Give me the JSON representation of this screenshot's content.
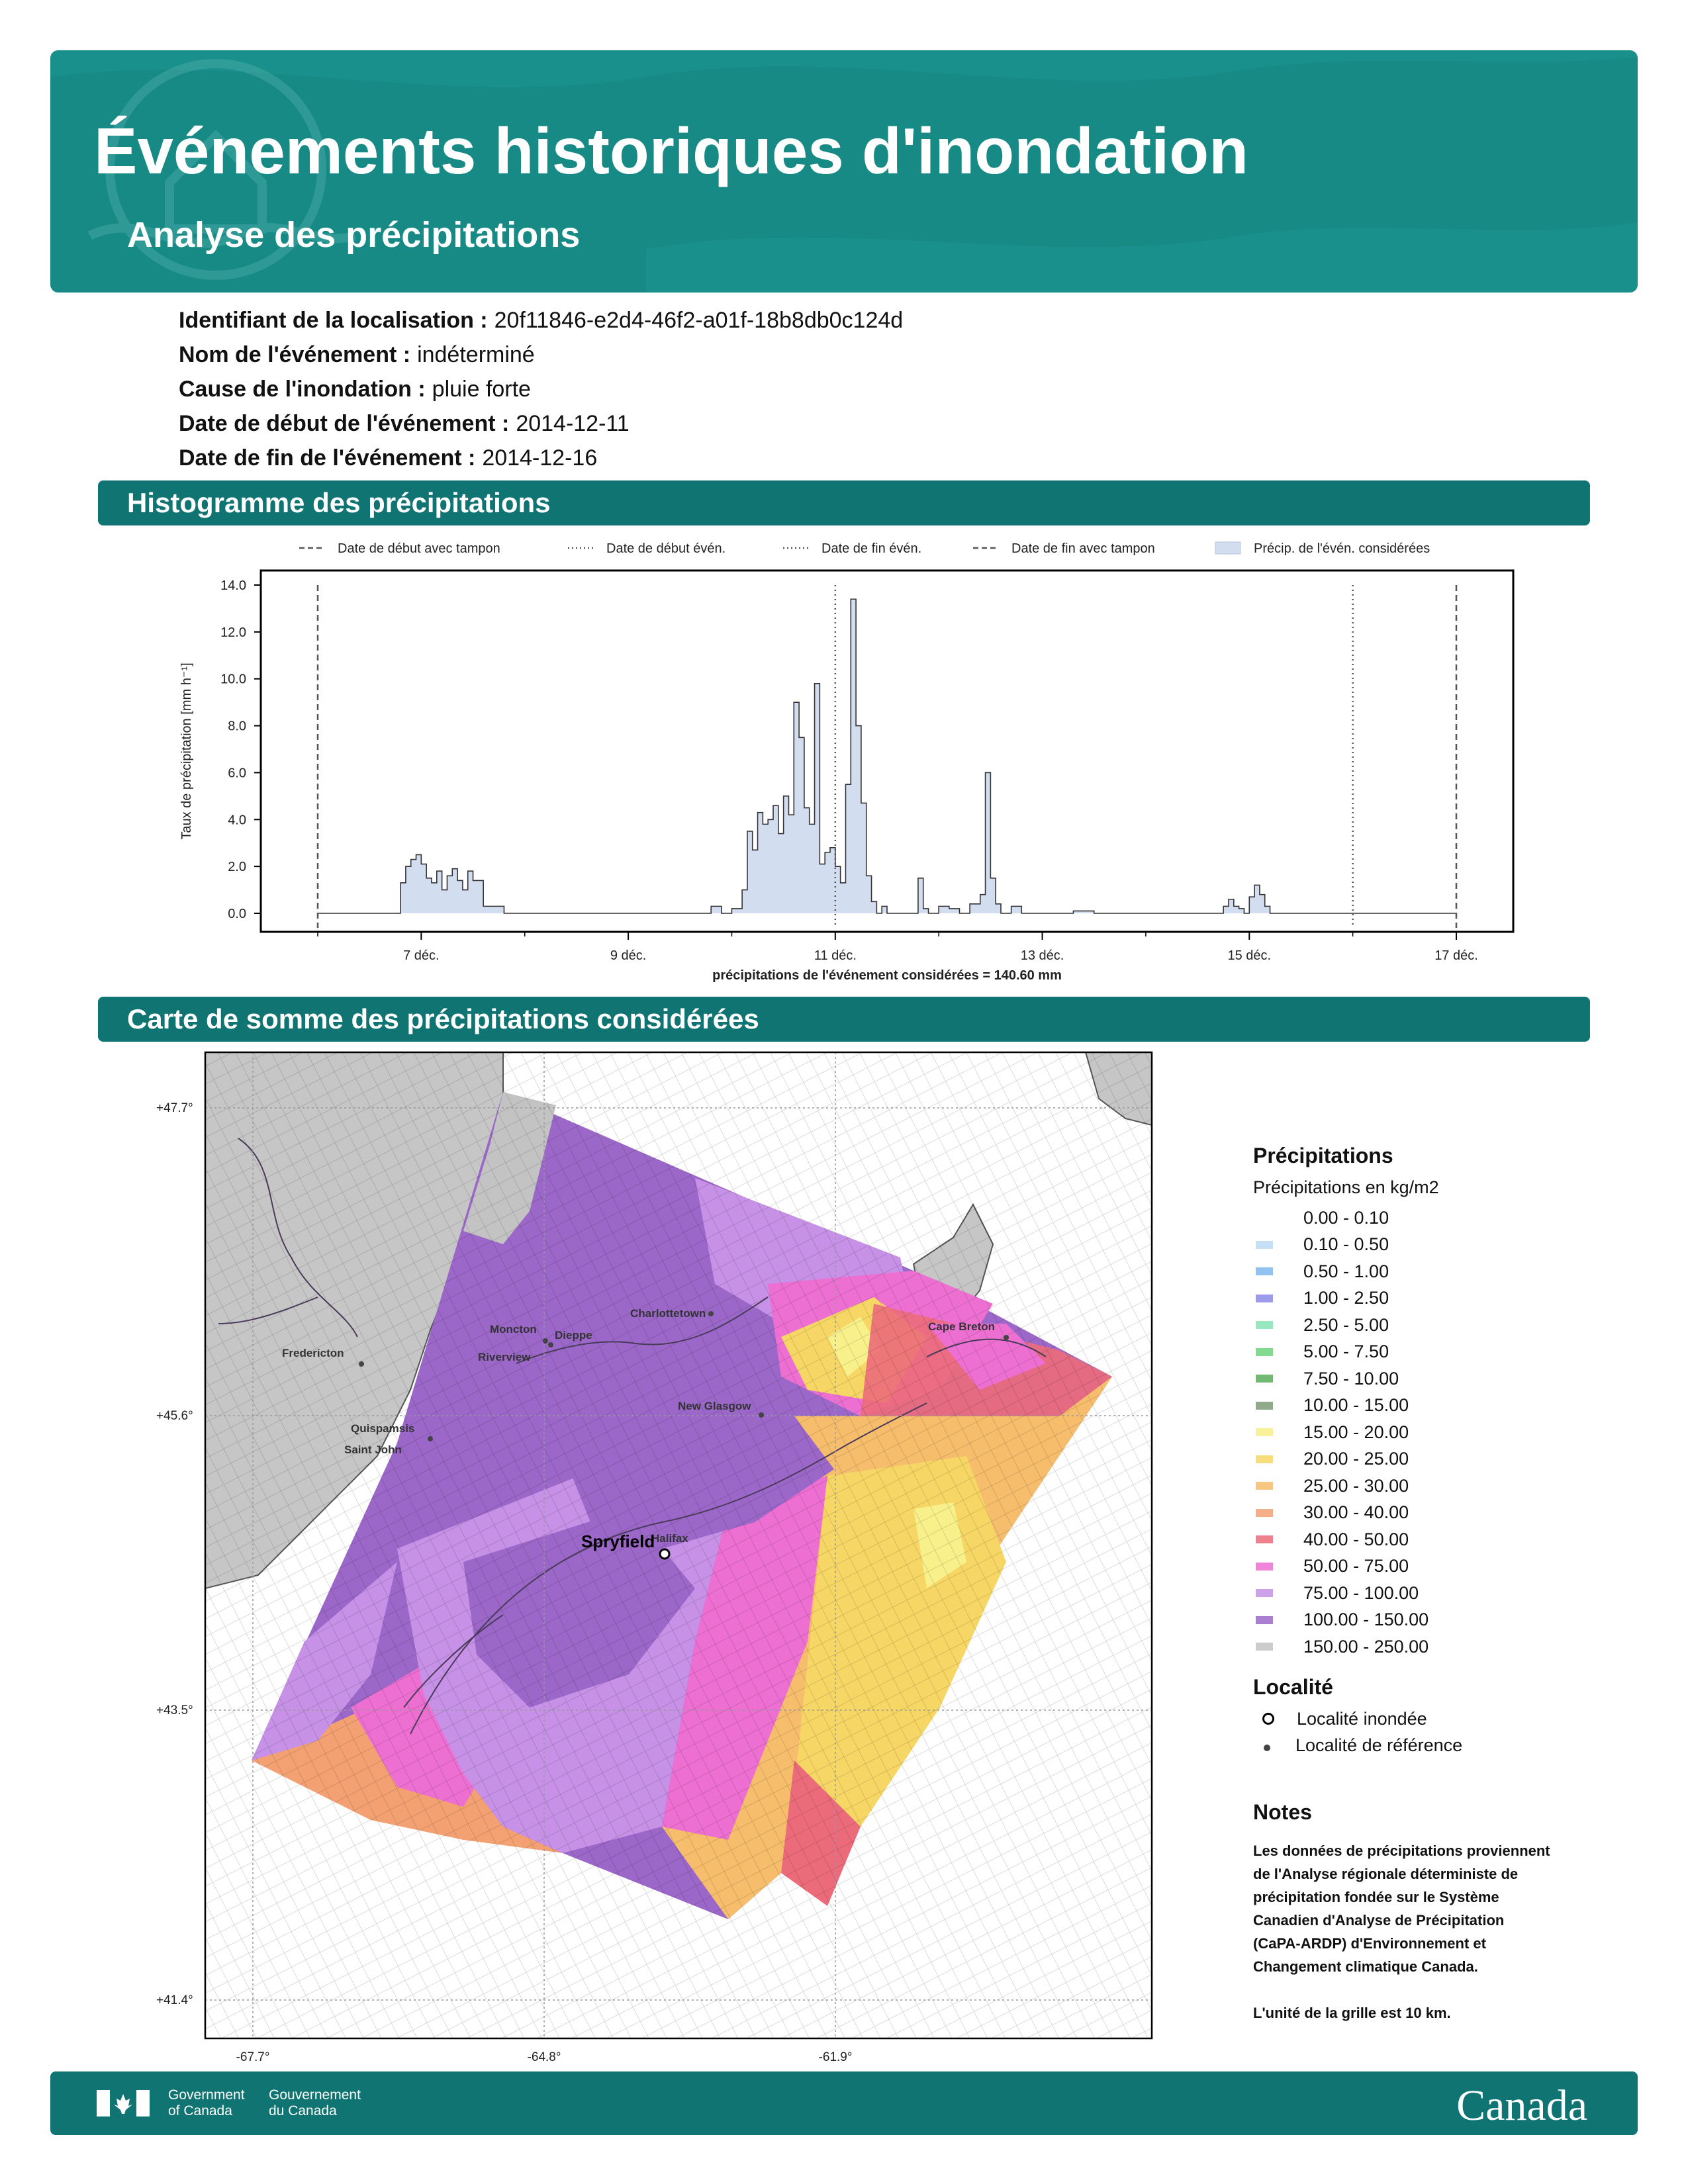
{
  "header": {
    "title": "Événements historiques d'inondation",
    "subtitle": "Analyse des précipitations"
  },
  "info": [
    {
      "label": "Identifiant de la localisation :",
      "value": "20f11846-e2d4-46f2-a01f-18b8db0c124d"
    },
    {
      "label": "Nom de l'événement :",
      "value": "indéterminé"
    },
    {
      "label": "Cause de l'inondation :",
      "value": "pluie forte"
    },
    {
      "label": "Date de début de l'événement :",
      "value": "2014-12-11"
    },
    {
      "label": "Date de fin de l'événement :",
      "value": "2014-12-16"
    }
  ],
  "sections": {
    "histogram": "Histogramme des précipitations",
    "map": "Carte de somme des précipitations considérées"
  },
  "chart_data": {
    "type": "area",
    "ylabel": "Taux de précipitation [mm h⁻¹]",
    "xlabel": "précipitations de l'événement considérées = 140.60 mm",
    "ylim": [
      0,
      14.0
    ],
    "yticks": [
      "0.0",
      "2.0",
      "4.0",
      "6.0",
      "8.0",
      "10.0",
      "12.0",
      "14.0"
    ],
    "xticks": [
      "7 déc.",
      "9 déc.",
      "11 déc.",
      "13 déc.",
      "15 déc.",
      "17 déc."
    ],
    "legend": [
      {
        "label": "Date de début avec tampon",
        "style": "dashed"
      },
      {
        "label": "Date de début évén.",
        "style": "dotted"
      },
      {
        "label": "Date de fin évén.",
        "style": "dotted"
      },
      {
        "label": "Date de fin avec tampon",
        "style": "dashed"
      },
      {
        "label": "Précip. de l'évén. considérées",
        "style": "fill"
      }
    ],
    "vlines": [
      {
        "day": 6.0,
        "style": "dashed"
      },
      {
        "day": 11.0,
        "style": "dotted"
      },
      {
        "day": 16.0,
        "style": "dotted"
      },
      {
        "day": 17.0,
        "style": "dashed"
      }
    ],
    "x_days": [
      6.0,
      6.25,
      6.5,
      6.75,
      6.8,
      6.85,
      6.9,
      6.95,
      7.0,
      7.05,
      7.1,
      7.15,
      7.2,
      7.25,
      7.3,
      7.35,
      7.4,
      7.45,
      7.5,
      7.6,
      7.8,
      8.0,
      8.5,
      9.0,
      9.5,
      9.7,
      9.8,
      9.9,
      10.0,
      10.1,
      10.15,
      10.2,
      10.25,
      10.3,
      10.35,
      10.4,
      10.45,
      10.5,
      10.55,
      10.6,
      10.65,
      10.7,
      10.75,
      10.8,
      10.85,
      10.9,
      10.95,
      11.0,
      11.05,
      11.1,
      11.15,
      11.2,
      11.25,
      11.3,
      11.35,
      11.4,
      11.45,
      11.5,
      11.6,
      11.7,
      11.8,
      11.85,
      11.9,
      12.0,
      12.1,
      12.2,
      12.3,
      12.4,
      12.45,
      12.5,
      12.55,
      12.6,
      12.7,
      12.8,
      13.0,
      13.3,
      13.5,
      13.6,
      13.7,
      14.0,
      14.5,
      14.7,
      14.75,
      14.8,
      14.85,
      14.9,
      14.95,
      15.0,
      15.05,
      15.1,
      15.15,
      15.2,
      15.3,
      15.5,
      16.0,
      16.5,
      17.0
    ],
    "values": [
      0.0,
      0.0,
      0.0,
      0.0,
      1.3,
      2.0,
      2.3,
      2.5,
      2.1,
      1.5,
      1.3,
      1.8,
      1.0,
      1.6,
      1.9,
      1.4,
      1.0,
      1.8,
      1.4,
      0.3,
      0.0,
      0.0,
      0.0,
      0.0,
      0.0,
      0.0,
      0.3,
      0.0,
      0.2,
      1.0,
      3.5,
      2.7,
      4.3,
      3.8,
      4.0,
      4.6,
      3.4,
      5.0,
      4.2,
      9.0,
      7.5,
      4.5,
      3.8,
      9.8,
      2.1,
      2.6,
      2.8,
      2.0,
      1.3,
      5.5,
      13.4,
      8.0,
      4.7,
      1.6,
      0.5,
      0.0,
      0.3,
      0.0,
      0.0,
      0.0,
      1.5,
      0.2,
      0.0,
      0.3,
      0.2,
      0.0,
      0.4,
      0.8,
      6.0,
      1.5,
      0.4,
      0.0,
      0.3,
      0.0,
      0.0,
      0.1,
      0.0,
      0.0,
      0.0,
      0.0,
      0.0,
      0.0,
      0.3,
      0.6,
      0.3,
      0.2,
      0.0,
      0.7,
      1.2,
      0.8,
      0.3,
      0.0,
      0.0,
      0.0,
      0.0,
      0.0,
      0.0
    ]
  },
  "map": {
    "lat_labels": [
      "+47.7°",
      "+45.6°",
      "+43.5°",
      "+41.4°"
    ],
    "lon_labels": [
      "-67.7°",
      "-64.8°",
      "-61.9°"
    ],
    "cities": [
      {
        "name": "Fredericton"
      },
      {
        "name": "Moncton"
      },
      {
        "name": "Dieppe"
      },
      {
        "name": "Riverview"
      },
      {
        "name": "Charlottetown"
      },
      {
        "name": "Cape Breton"
      },
      {
        "name": "New Glasgow"
      },
      {
        "name": "Quispamsis"
      },
      {
        "name": "Saint John"
      },
      {
        "name": "Halifax"
      }
    ],
    "flooded_locality": "Spryfield"
  },
  "legend": {
    "title": "Précipitations",
    "subtitle": "Précipitations en kg/m2",
    "bins": [
      {
        "label": "0.00 - 0.10",
        "color": "#ffffff"
      },
      {
        "label": "0.10 - 0.50",
        "color": "#bcd9f3"
      },
      {
        "label": "0.50 - 1.00",
        "color": "#7fb7ee"
      },
      {
        "label": "1.00 - 2.50",
        "color": "#8c8ae8"
      },
      {
        "label": "2.50 - 5.00",
        "color": "#86e3b3"
      },
      {
        "label": "5.00 - 7.50",
        "color": "#6fd47d"
      },
      {
        "label": "7.50 - 10.00",
        "color": "#59ae59"
      },
      {
        "label": "10.00 - 15.00",
        "color": "#7c9b76"
      },
      {
        "label": "15.00 - 20.00",
        "color": "#f8f08a"
      },
      {
        "label": "20.00 - 25.00",
        "color": "#f6d765"
      },
      {
        "label": "25.00 - 30.00",
        "color": "#f6bd6c"
      },
      {
        "label": "30.00 - 40.00",
        "color": "#f3a173"
      },
      {
        "label": "40.00 - 50.00",
        "color": "#ec6b7a"
      },
      {
        "label": "50.00 - 75.00",
        "color": "#ec6fd1"
      },
      {
        "label": "75.00 - 100.00",
        "color": "#c691e6"
      },
      {
        "label": "100.00 - 150.00",
        "color": "#9b67c8"
      },
      {
        "label": "150.00 - 250.00",
        "color": "#c3c3c3"
      }
    ],
    "locality_title": "Localité",
    "flooded_label": "Localité inondée",
    "reference_label": "Localité de référence",
    "notes_title": "Notes",
    "notes_lines": [
      "Les données de précipitations proviennent",
      "de l'Analyse régionale déterministe de",
      "précipitation fondée sur le Système",
      "Canadien d'Analyse de Précipitation",
      "(CaPA-ARDP) d'Environnement et",
      "Changement climatique Canada."
    ],
    "grid_note": "L'unité de la grille est 10 km."
  },
  "footer": {
    "gov_en_1": "Government",
    "gov_en_2": "of Canada",
    "gov_fr_1": "Gouvernement",
    "gov_fr_2": "du Canada",
    "wordmark": "Canada"
  }
}
